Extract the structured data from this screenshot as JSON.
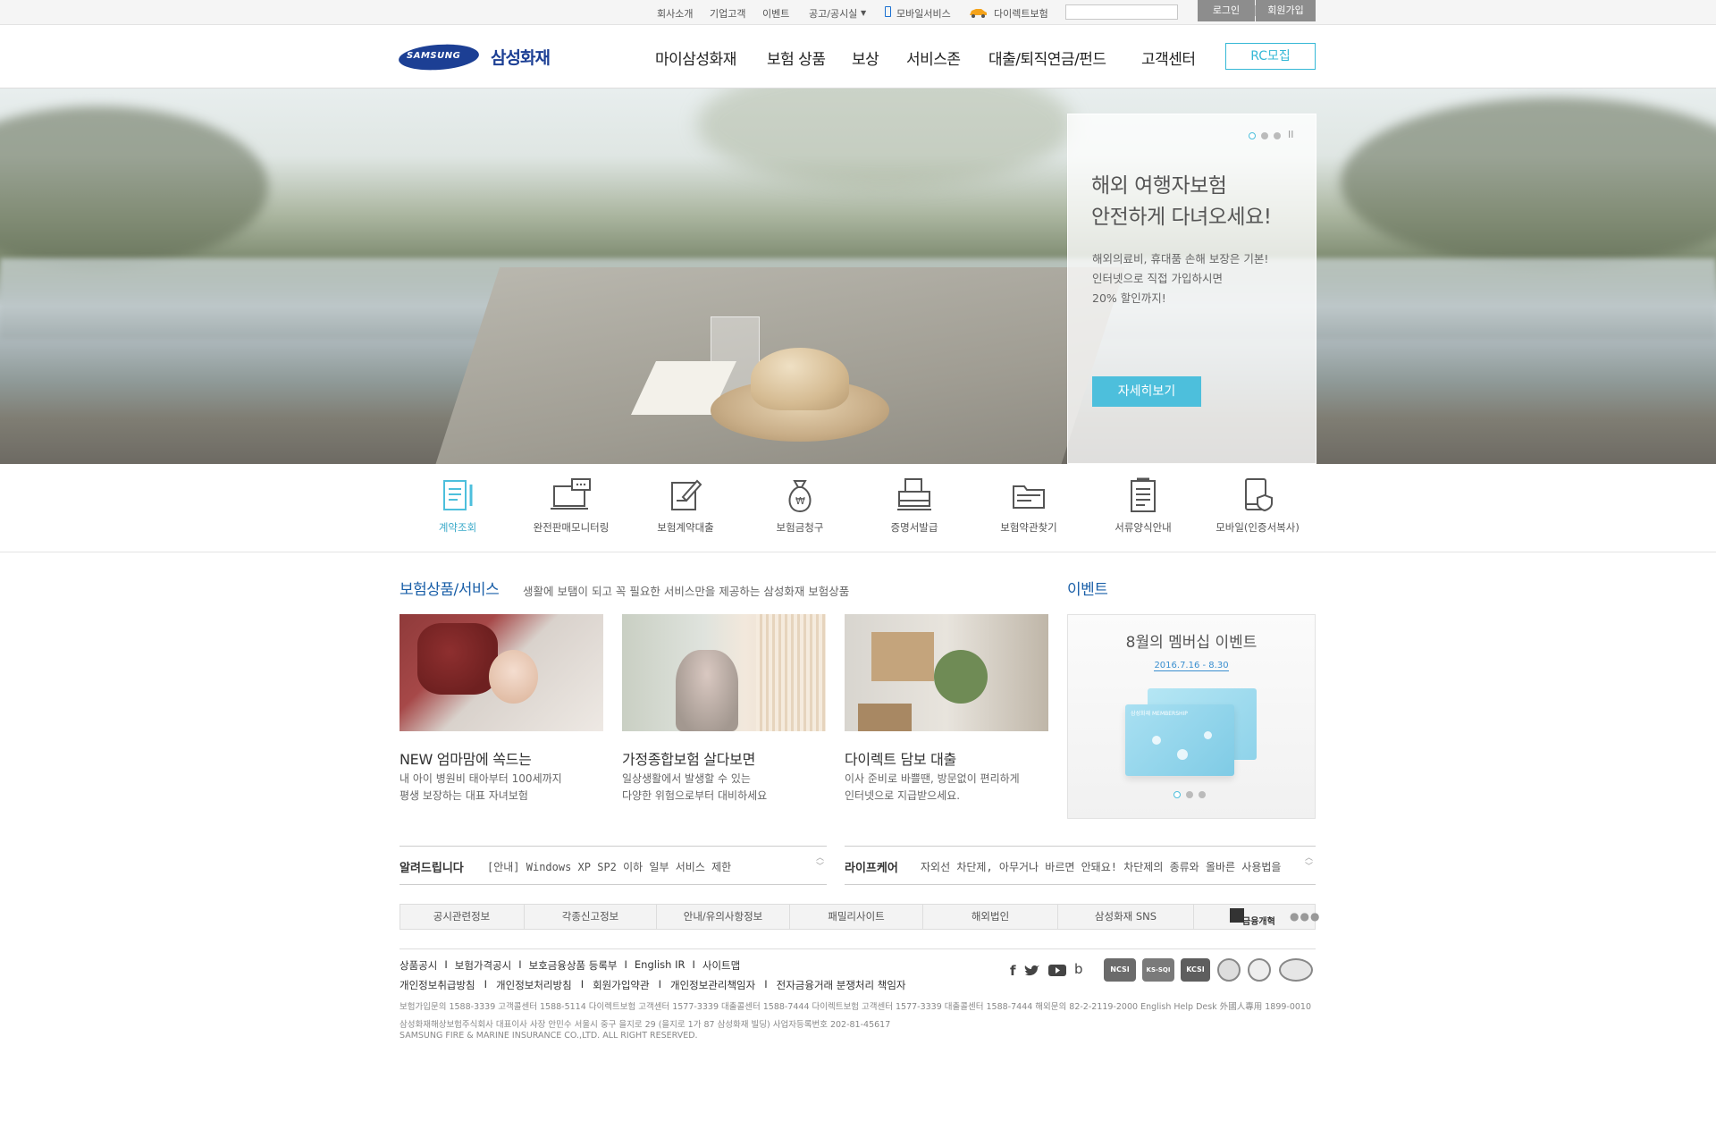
{
  "topbar": {
    "links": [
      "회사소개",
      "기업고객",
      "이벤트",
      "공고/공시실",
      "모바일서비스",
      "다이렉트보험"
    ],
    "login": "로그인",
    "join": "회원가입"
  },
  "header": {
    "logo_text": "SAMSUNG",
    "brand": "삼성화재",
    "nav": [
      "마이삼성화재",
      "보험 상품",
      "보상",
      "서비스존",
      "대출/퇴직연금/펀드",
      "고객센터"
    ],
    "rc_button": "RC모집"
  },
  "hero": {
    "title_line1": "해외 여행자보험",
    "title_line2": "안전하게 다녀오세요!",
    "desc_line1": "해외의료비, 휴대품 손해 보장은 기본!",
    "desc_line2": "인터넷으로 직접 가입하시면",
    "desc_line3": "20% 할인까지!",
    "button": "자세히보기",
    "pause_label": "II"
  },
  "quick_menu": [
    {
      "label": "계약조회",
      "icon": "contract-document-icon",
      "active": true
    },
    {
      "label": "완전판매모니터링",
      "icon": "monitor-chat-icon",
      "active": false
    },
    {
      "label": "보험계약대출",
      "icon": "pen-document-icon",
      "active": false
    },
    {
      "label": "보험금청구",
      "icon": "money-bag-icon",
      "active": false
    },
    {
      "label": "증명서발급",
      "icon": "printer-icon",
      "active": false
    },
    {
      "label": "보험약관찾기",
      "icon": "folder-icon",
      "active": false
    },
    {
      "label": "서류양식안내",
      "icon": "clipboard-icon",
      "active": false
    },
    {
      "label": "모바일(인증서복사)",
      "icon": "mobile-shield-icon",
      "active": false
    }
  ],
  "products": {
    "title": "보험상품/서비스",
    "subtitle": "생활에 보탬이 되고 꼭 필요한 서비스만을 제공하는 삼성화재 보험상품",
    "cards": [
      {
        "title": "NEW 엄마맘에 쏙드는",
        "desc1": "내 아이 병원비 태아부터 100세까지",
        "desc2": "평생 보장하는 대표 자녀보험"
      },
      {
        "title": "가정종합보험 살다보면",
        "desc1": "일상생활에서 발생할 수 있는",
        "desc2": "다양한 위험으로부터 대비하세요"
      },
      {
        "title": "다이렉트 담보 대출",
        "desc1": "이사 준비로 바쁠땐, 방문없이 편리하게",
        "desc2": "인터넷으로 지급받으세요."
      }
    ]
  },
  "event": {
    "heading": "이벤트",
    "title": "8월의 멤버십 이벤트",
    "date": "2016.7.16 - 8.30",
    "card_brand": "삼성화재 MEMBERSHIP"
  },
  "notices": [
    {
      "label": "알려드립니다",
      "text": "[안내] Windows XP SP2 이하 일부 서비스 제한"
    },
    {
      "label": "라이프케어",
      "text": "자외선 차단제, 아무거나 바르면 안돼요! 차단제의 종류와 올바른 사용법을 ..."
    }
  ],
  "tabs": [
    "공시관련정보",
    "각종신고정보",
    "안내/유의사항정보",
    "패밀리사이트",
    "해외법인",
    "삼성화재 SNS"
  ],
  "tabs_logo": "금융개혁",
  "footer": {
    "links1": [
      "상품공시",
      "보험가격공시",
      "보호금융상품 등록부",
      "English IR",
      "사이트맵"
    ],
    "links2": [
      "개인정보취급방침",
      "개인정보처리방침",
      "회원가입약관",
      "개인정보관리책임자",
      "전자금융거래 분쟁처리 책임자"
    ],
    "sns": [
      "facebook-icon",
      "twitter-icon",
      "youtube-icon",
      "blog-icon"
    ],
    "phones": "보험가입문의 1588-3339    고객콜센터 1588-5114    다이렉트보험 고객센터 1577-3339    대출콜센터 1588-7444    다이렉트보험 고객센터 1577-3339    대출콜센터 1588-7444    해외문의 82-2-2119-2000    English Help Desk 外國人專用 1899-0010",
    "address": "삼성화재해상보험주식회사 대표이사 사장 안민수   서울시 중구 을지로 29 (을지로 1가 87 삼성화재 빌딩) 사업자등록번호 202-81-45617",
    "copyright": "SAMSUNG FIRE & MARINE INSURANCE CO.,LTD.  ALL RIGHT RESERVED.",
    "badges": [
      "NCSI",
      "KS-SQI",
      "KCSI"
    ]
  },
  "colors": {
    "accent": "#4dbfdc",
    "brand_blue": "#1a5fa8",
    "samsung_blue": "#1c3f94"
  }
}
